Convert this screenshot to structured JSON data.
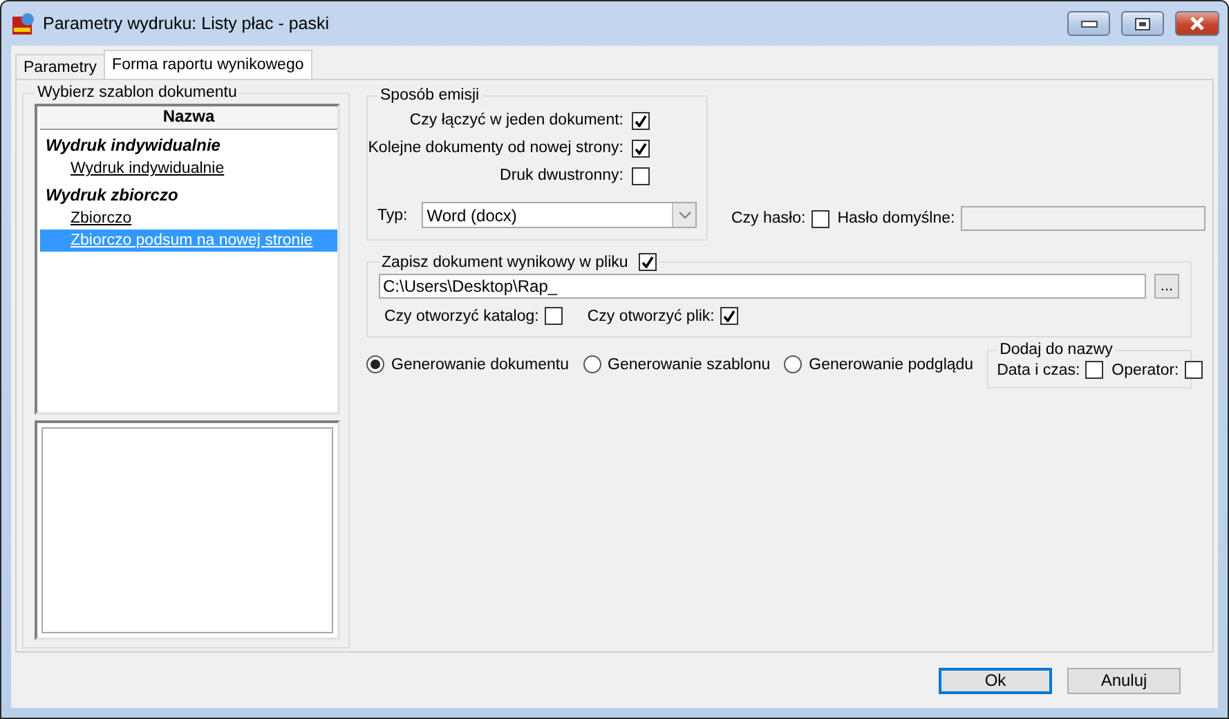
{
  "window": {
    "title": "Parametry wydruku: Listy płac - paski"
  },
  "tabs": [
    {
      "label": "Parametry",
      "selected": false
    },
    {
      "label": "Forma raportu wynikowego",
      "selected": true
    }
  ],
  "template_panel": {
    "title": "Wybierz szablon dokumentu",
    "column": "Nazwa",
    "groups": [
      {
        "label": "Wydruk indywidualnie",
        "children": [
          {
            "label": "Wydruk indywidualnie",
            "selected": false
          }
        ]
      },
      {
        "label": "Wydruk zbiorczo",
        "children": [
          {
            "label": "Zbiorczo",
            "selected": false
          },
          {
            "label": "Zbiorczo podsum na nowej stronie",
            "selected": true
          }
        ]
      }
    ]
  },
  "emission": {
    "title": "Sposób emisji",
    "options": [
      {
        "label": "Czy łączyć w jeden dokument:",
        "checked": true
      },
      {
        "label": "Kolejne dokumenty od nowej strony:",
        "checked": true
      },
      {
        "label": "Druk dwustronny:",
        "checked": false
      }
    ],
    "type_label": "Typ:",
    "type_value": "Word (docx)"
  },
  "password": {
    "label": "Czy hasło:",
    "checked": false,
    "default_label": "Hasło domyślne:"
  },
  "save": {
    "label": "Zapisz dokument wynikowy w pliku",
    "checked": true,
    "path": "C:\\Users\\Desktop\\Rap_",
    "browse": "...",
    "open_folder": {
      "label": "Czy otworzyć katalog:",
      "checked": false
    },
    "open_file": {
      "label": "Czy otworzyć plik:",
      "checked": true
    }
  },
  "modes": [
    {
      "label": "Generowanie dokumentu",
      "selected": true
    },
    {
      "label": "Generowanie szablonu",
      "selected": false
    },
    {
      "label": "Generowanie podglądu",
      "selected": false
    }
  ],
  "name_suffix": {
    "title": "Dodaj do nazwy",
    "options": [
      {
        "label": "Data i czas:",
        "checked": false
      },
      {
        "label": "Operator:",
        "checked": false
      }
    ]
  },
  "buttons": [
    {
      "label": "Ok",
      "default": true
    },
    {
      "label": "Anuluj",
      "default": false
    }
  ]
}
